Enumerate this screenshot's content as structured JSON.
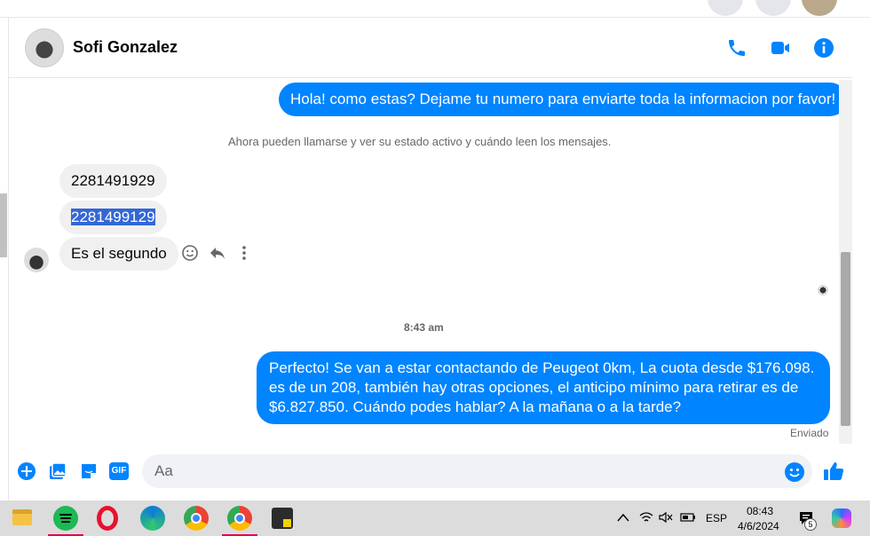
{
  "contact": {
    "name": "Sofi Gonzalez"
  },
  "messages": {
    "outgoing_1": "Hola! como estas? Dejame tu numero para enviarte toda la informacion por favor!",
    "system_notice": "Ahora pueden llamarse y ver su estado activo y cuándo leen los mensajes.",
    "incoming_1": "2281491929",
    "incoming_2": "2281499129",
    "incoming_3": "Es el segundo",
    "timestamp": "8:43 am",
    "outgoing_2": "Perfecto!  Se van a estar contactando de Peugeot 0km, La cuota desde $176.098. es de un 208, también hay otras opciones, el anticipo mínimo para retirar es de $6.827.850. Cuándo podes hablar? A la mañana o a la tarde?",
    "status": "Enviado"
  },
  "composer": {
    "placeholder": "Aa",
    "gif_label": "GIF"
  },
  "taskbar": {
    "language": "ESP",
    "time": "08:43",
    "date": "4/6/2024",
    "notification_count": "5"
  },
  "colors": {
    "accent": "#0084ff",
    "selection": "#3367d6"
  }
}
